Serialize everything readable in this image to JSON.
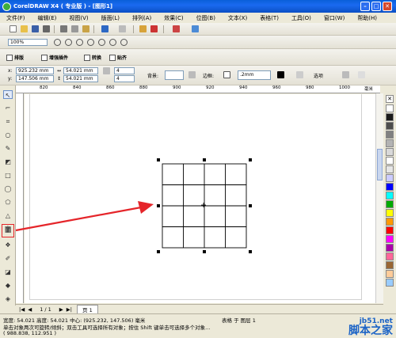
{
  "window": {
    "title": "CorelDRAW X4 ( 专业版 ) - [图形1]",
    "controls": [
      "–",
      "□",
      "✕"
    ]
  },
  "menu": [
    "文件(F)",
    "编辑(E)",
    "视图(V)",
    "版面(L)",
    "排列(A)",
    "效果(C)",
    "位图(B)",
    "文本(X)",
    "表格(T)",
    "工具(O)",
    "窗口(W)",
    "帮助(H)"
  ],
  "standard_toolbar": {
    "zoom_value": "100%"
  },
  "table_toolbar": {
    "buttons": [
      "排版",
      "增强插件",
      "转换",
      "贴齐"
    ]
  },
  "property_bar": {
    "x": "925.232 mm",
    "y": "147.506 mm",
    "width": "54.021 mm",
    "height": "54.021 mm",
    "rows": "4",
    "cols": "4",
    "background_label": "背景:",
    "border_label": "边框:",
    "border_width": ".2mm",
    "options_label": "选项"
  },
  "ruler": {
    "ticks": [
      "820",
      "840",
      "860",
      "880",
      "900",
      "920",
      "940",
      "960",
      "980",
      "1000"
    ],
    "unit": "毫米"
  },
  "page_nav": {
    "counter": "1 / 1",
    "tab": "页 1"
  },
  "status": {
    "line1": "宽度: 54.021 高度: 54.021 中心: (925.232, 147.506) 毫米",
    "line1_right": "表格 于 图层 1",
    "line2": "单击对象两次可旋转/倾斜；双击工具可选择所有对象；按住 Shift 键单击可选择多个对象...",
    "coords": "( 988.838, 112.951 )"
  },
  "table": {
    "rows": 4,
    "cols": 4
  },
  "palette": [
    "#ffffff",
    "#1a1a1a",
    "#4d4d4d",
    "#808080",
    "#b3b3b3",
    "#d9d9d9",
    "#ffffff",
    "#e6e6e6",
    "#ccccff",
    "#0000ff",
    "#00ffff",
    "#00aa00",
    "#ffff00",
    "#ff9900",
    "#ff0000",
    "#ff00ff",
    "#aa00aa",
    "#ff6699",
    "#996633",
    "#ffcc99",
    "#99ccff"
  ],
  "colors": {
    "annotation_red": "#e5252a",
    "title_blue": "#0a5fd8"
  },
  "watermark": {
    "site": "jb51.net",
    "name": "脚本之家"
  }
}
